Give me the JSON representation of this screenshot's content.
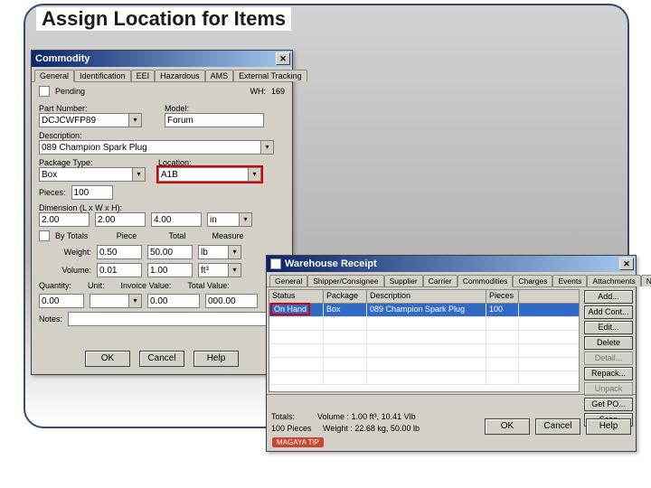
{
  "page": {
    "title": "Assign Location for Items"
  },
  "commodity": {
    "title": "Commodity",
    "tabs": [
      "General",
      "Identification",
      "EEI",
      "Hazardous",
      "AMS",
      "External Tracking"
    ],
    "pending_label": "Pending",
    "wh_lbl": "WH:",
    "wh_val": "169",
    "partnum_lbl": "Part Number:",
    "partnum_val": "DCJCWFP89",
    "model_lbl": "Model:",
    "model_val": "Forum",
    "desc_lbl": "Description:",
    "desc_val": "089 Champion Spark Plug",
    "pkgtype_lbl": "Package Type:",
    "pkgtype_val": "Box",
    "location_lbl": "Location:",
    "location_val": "A1B",
    "pieces_lbl": "Pieces:",
    "pieces_val": "100",
    "dim_lbl": "Dimension (L x W x H):",
    "dim_l": "2.00",
    "dim_w": "2.00",
    "dim_h": "4.00",
    "dim_u": "in",
    "bytot_lbl": "By Totals",
    "piece_lbl": "Piece",
    "total_lbl": "Total",
    "meas_lbl": "Measure",
    "weight_lbl": "Weight:",
    "weight_p": "0.50",
    "weight_t": "50.00",
    "weight_u": "lb",
    "vol_lbl": "Volume:",
    "vol_p": "0.01",
    "vol_t": "1.00",
    "vol_u": "ft³",
    "qty_lbl": "Quantity:",
    "unit_lbl": "Unit:",
    "invval_lbl": "Invoice Value:",
    "totval_lbl": "Total Value:",
    "qty_val": "0.00",
    "unit_val": "",
    "inv_val": "0.00",
    "tot_val": "000.00",
    "notes_lbl": "Notes:",
    "ok": "OK",
    "cancel": "Cancel",
    "help": "Help"
  },
  "warehouse": {
    "title": "Warehouse Receipt",
    "tabs": [
      "General",
      "Shipper/Consignee",
      "Supplier",
      "Carrier",
      "Commodities",
      "Charges",
      "Events",
      "Attachments",
      "Note"
    ],
    "hdr": {
      "status": "Status",
      "package": "Package",
      "desc": "Description",
      "pieces": "Pieces"
    },
    "rows": [
      {
        "status": "On Hand",
        "package": "Box",
        "desc": "089 Champion Spark Plug",
        "pieces": "100"
      }
    ],
    "side": {
      "add": "Add...",
      "addcont": "Add Cont...",
      "edit": "Edit...",
      "delete": "Delete",
      "detail": "Detail...",
      "repack": "Repack...",
      "unpack": "Unpack",
      "getpo": "Get PO...",
      "scan": "Scan"
    },
    "totals_lbl": "Totals:",
    "pieces_line": "100 Pieces",
    "volume_line": "Volume : 1.00 ft³, 10.41 Vlb",
    "weight_line": "Weight : 22.68 kg, 50.00 lb",
    "tip": "MAGAYA TIP",
    "ok": "OK",
    "cancel": "Cancel",
    "help": "Help"
  }
}
